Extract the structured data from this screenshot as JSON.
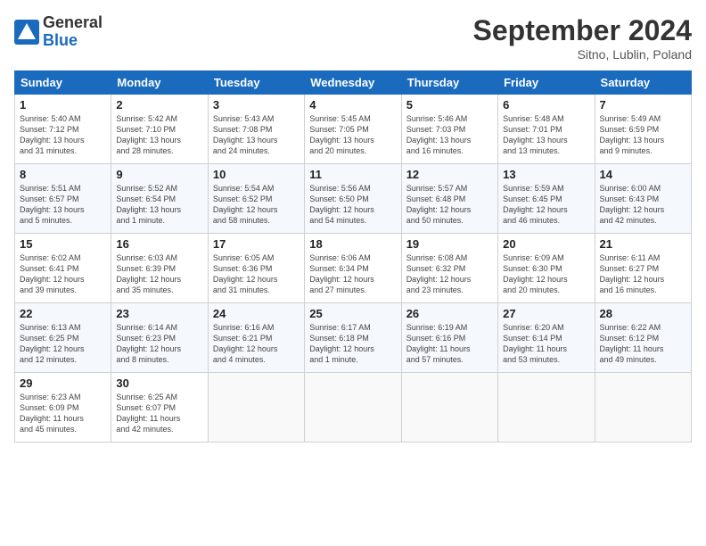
{
  "header": {
    "logo_general": "General",
    "logo_blue": "Blue",
    "month_title": "September 2024",
    "location": "Sitno, Lublin, Poland"
  },
  "days_of_week": [
    "Sunday",
    "Monday",
    "Tuesday",
    "Wednesday",
    "Thursday",
    "Friday",
    "Saturday"
  ],
  "weeks": [
    [
      {
        "day": "1",
        "info": "Sunrise: 5:40 AM\nSunset: 7:12 PM\nDaylight: 13 hours\nand 31 minutes."
      },
      {
        "day": "2",
        "info": "Sunrise: 5:42 AM\nSunset: 7:10 PM\nDaylight: 13 hours\nand 28 minutes."
      },
      {
        "day": "3",
        "info": "Sunrise: 5:43 AM\nSunset: 7:08 PM\nDaylight: 13 hours\nand 24 minutes."
      },
      {
        "day": "4",
        "info": "Sunrise: 5:45 AM\nSunset: 7:05 PM\nDaylight: 13 hours\nand 20 minutes."
      },
      {
        "day": "5",
        "info": "Sunrise: 5:46 AM\nSunset: 7:03 PM\nDaylight: 13 hours\nand 16 minutes."
      },
      {
        "day": "6",
        "info": "Sunrise: 5:48 AM\nSunset: 7:01 PM\nDaylight: 13 hours\nand 13 minutes."
      },
      {
        "day": "7",
        "info": "Sunrise: 5:49 AM\nSunset: 6:59 PM\nDaylight: 13 hours\nand 9 minutes."
      }
    ],
    [
      {
        "day": "8",
        "info": "Sunrise: 5:51 AM\nSunset: 6:57 PM\nDaylight: 13 hours\nand 5 minutes."
      },
      {
        "day": "9",
        "info": "Sunrise: 5:52 AM\nSunset: 6:54 PM\nDaylight: 13 hours\nand 1 minute."
      },
      {
        "day": "10",
        "info": "Sunrise: 5:54 AM\nSunset: 6:52 PM\nDaylight: 12 hours\nand 58 minutes."
      },
      {
        "day": "11",
        "info": "Sunrise: 5:56 AM\nSunset: 6:50 PM\nDaylight: 12 hours\nand 54 minutes."
      },
      {
        "day": "12",
        "info": "Sunrise: 5:57 AM\nSunset: 6:48 PM\nDaylight: 12 hours\nand 50 minutes."
      },
      {
        "day": "13",
        "info": "Sunrise: 5:59 AM\nSunset: 6:45 PM\nDaylight: 12 hours\nand 46 minutes."
      },
      {
        "day": "14",
        "info": "Sunrise: 6:00 AM\nSunset: 6:43 PM\nDaylight: 12 hours\nand 42 minutes."
      }
    ],
    [
      {
        "day": "15",
        "info": "Sunrise: 6:02 AM\nSunset: 6:41 PM\nDaylight: 12 hours\nand 39 minutes."
      },
      {
        "day": "16",
        "info": "Sunrise: 6:03 AM\nSunset: 6:39 PM\nDaylight: 12 hours\nand 35 minutes."
      },
      {
        "day": "17",
        "info": "Sunrise: 6:05 AM\nSunset: 6:36 PM\nDaylight: 12 hours\nand 31 minutes."
      },
      {
        "day": "18",
        "info": "Sunrise: 6:06 AM\nSunset: 6:34 PM\nDaylight: 12 hours\nand 27 minutes."
      },
      {
        "day": "19",
        "info": "Sunrise: 6:08 AM\nSunset: 6:32 PM\nDaylight: 12 hours\nand 23 minutes."
      },
      {
        "day": "20",
        "info": "Sunrise: 6:09 AM\nSunset: 6:30 PM\nDaylight: 12 hours\nand 20 minutes."
      },
      {
        "day": "21",
        "info": "Sunrise: 6:11 AM\nSunset: 6:27 PM\nDaylight: 12 hours\nand 16 minutes."
      }
    ],
    [
      {
        "day": "22",
        "info": "Sunrise: 6:13 AM\nSunset: 6:25 PM\nDaylight: 12 hours\nand 12 minutes."
      },
      {
        "day": "23",
        "info": "Sunrise: 6:14 AM\nSunset: 6:23 PM\nDaylight: 12 hours\nand 8 minutes."
      },
      {
        "day": "24",
        "info": "Sunrise: 6:16 AM\nSunset: 6:21 PM\nDaylight: 12 hours\nand 4 minutes."
      },
      {
        "day": "25",
        "info": "Sunrise: 6:17 AM\nSunset: 6:18 PM\nDaylight: 12 hours\nand 1 minute."
      },
      {
        "day": "26",
        "info": "Sunrise: 6:19 AM\nSunset: 6:16 PM\nDaylight: 11 hours\nand 57 minutes."
      },
      {
        "day": "27",
        "info": "Sunrise: 6:20 AM\nSunset: 6:14 PM\nDaylight: 11 hours\nand 53 minutes."
      },
      {
        "day": "28",
        "info": "Sunrise: 6:22 AM\nSunset: 6:12 PM\nDaylight: 11 hours\nand 49 minutes."
      }
    ],
    [
      {
        "day": "29",
        "info": "Sunrise: 6:23 AM\nSunset: 6:09 PM\nDaylight: 11 hours\nand 45 minutes."
      },
      {
        "day": "30",
        "info": "Sunrise: 6:25 AM\nSunset: 6:07 PM\nDaylight: 11 hours\nand 42 minutes."
      },
      {
        "day": "",
        "info": ""
      },
      {
        "day": "",
        "info": ""
      },
      {
        "day": "",
        "info": ""
      },
      {
        "day": "",
        "info": ""
      },
      {
        "day": "",
        "info": ""
      }
    ]
  ]
}
